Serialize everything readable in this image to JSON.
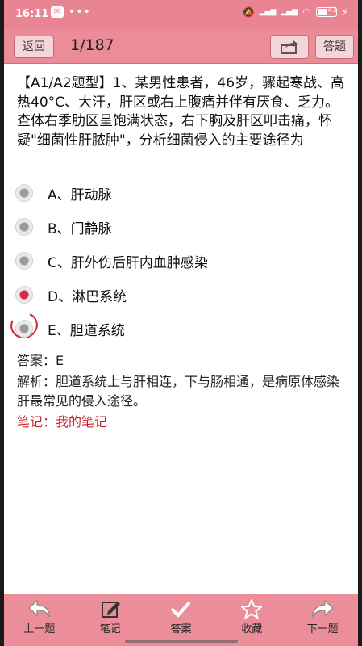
{
  "status": {
    "time": "16:11",
    "battery": "43"
  },
  "header": {
    "back_label": "返回",
    "progress": "1/187",
    "answer_label": "答题"
  },
  "question": "【A1/A2题型】1、某男性患者，46岁，骤起寒战、高热40°C、大汗，肝区或右上腹痛并伴有厌食、乏力。查体右季肋区呈饱满状态，右下胸及肝区叩击痛，怀疑\"细菌性肝脓肿\"，分析细菌侵入的主要途径为",
  "options": [
    {
      "label": "A、肝动脉",
      "selected": false
    },
    {
      "label": "B、门静脉",
      "selected": false
    },
    {
      "label": "C、肝外伤后肝内血肿感染",
      "selected": false
    },
    {
      "label": "D、淋巴系统",
      "selected": true
    },
    {
      "label": "E、胆道系统",
      "selected": false,
      "circled": true
    }
  ],
  "answer": "答案：E",
  "analysis": "解析：胆道系统上与肝相连，下与肠相通，是病原体感染肝最常见的侵入途径。",
  "note": "笔记：我的笔记",
  "toolbar": {
    "prev": "上一题",
    "notes": "笔记",
    "answer": "答案",
    "favorite": "收藏",
    "next": "下一题"
  },
  "colors": {
    "accent": "#eb8c98",
    "selected": "#d82a45",
    "note": "#cc1f2c"
  }
}
